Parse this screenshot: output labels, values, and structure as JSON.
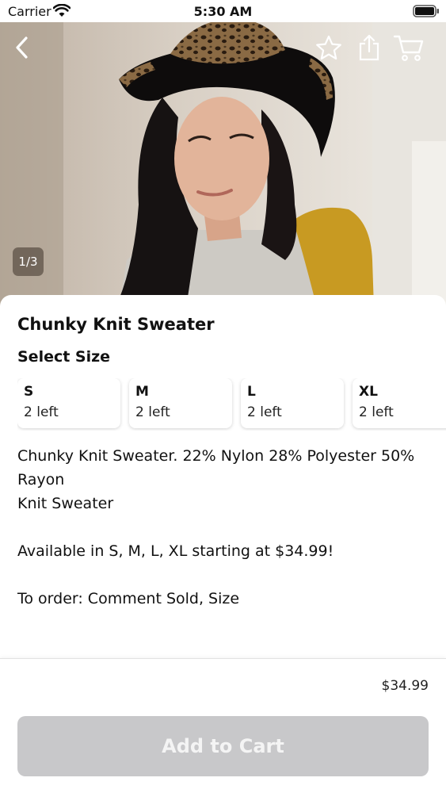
{
  "status_bar": {
    "carrier": "Carrier",
    "time": "5:30 AM",
    "icons": [
      "wifi-icon",
      "battery-icon"
    ]
  },
  "header": {
    "icons": [
      "chevron-left-icon",
      "star-icon",
      "share-icon",
      "cart-icon"
    ],
    "image_counter": "1/3"
  },
  "product": {
    "title": "Chunky Knit Sweater",
    "size_heading": "Select Size",
    "sizes": [
      {
        "name": "S",
        "stock": "2 left"
      },
      {
        "name": "M",
        "stock": "2 left"
      },
      {
        "name": "L",
        "stock": "2 left"
      },
      {
        "name": "XL",
        "stock": "2 left"
      }
    ],
    "description_lines": [
      "Chunky Knit Sweater. 22% Nylon 28% Polyester 50% Rayon",
      "Knit Sweater",
      "",
      "Available in S, M, L, XL starting at $34.99!",
      "",
      "To order: Comment Sold, Size"
    ]
  },
  "footer": {
    "price": "$34.99",
    "add_to_cart_label": "Add to Cart"
  },
  "colors": {
    "button_disabled_bg": "#c8c8ca",
    "sweater_accent": "#c89a22"
  }
}
